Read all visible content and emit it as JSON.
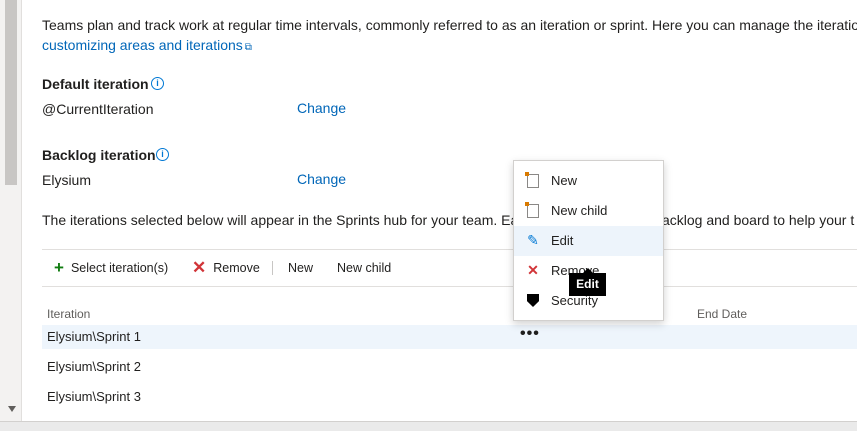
{
  "intro": {
    "line1": "Teams plan and track work at regular time intervals, commonly referred to as an iteration or sprint. Here you can manage the iteratio",
    "link": "customizing areas and iterations"
  },
  "default_iteration": {
    "heading": "Default iteration",
    "value": "@CurrentIteration",
    "change": "Change"
  },
  "backlog_iteration": {
    "heading": "Backlog iteration",
    "value": "Elysium",
    "change": "Change"
  },
  "sprints_note": {
    "left": "The iterations selected below will appear in the Sprints hub for your team. Ea",
    "right": "acklog and board to help your t"
  },
  "toolbar": {
    "select": "Select iteration(s)",
    "remove": "Remove",
    "new": "New",
    "new_child": "New child"
  },
  "table": {
    "columns": {
      "iteration": "Iteration",
      "end_date": "End Date"
    },
    "rows": [
      {
        "iteration": "Elysium\\Sprint 1",
        "selected": true
      },
      {
        "iteration": "Elysium\\Sprint 2",
        "selected": false
      },
      {
        "iteration": "Elysium\\Sprint 3",
        "selected": false
      }
    ],
    "more": "•••"
  },
  "context_menu": {
    "items": [
      {
        "label": "New",
        "icon": "new-document-icon"
      },
      {
        "label": "New child",
        "icon": "new-child-document-icon"
      },
      {
        "label": "Edit",
        "icon": "pencil-icon",
        "hover": true
      },
      {
        "label": "Remove",
        "icon": "cross-icon"
      },
      {
        "label": "Security",
        "icon": "shield-icon"
      }
    ]
  },
  "tooltip": {
    "text": "Edit"
  },
  "colors": {
    "link": "#0066b8",
    "add": "#107c10",
    "remove": "#d13438",
    "hover": "#edf4fb"
  }
}
